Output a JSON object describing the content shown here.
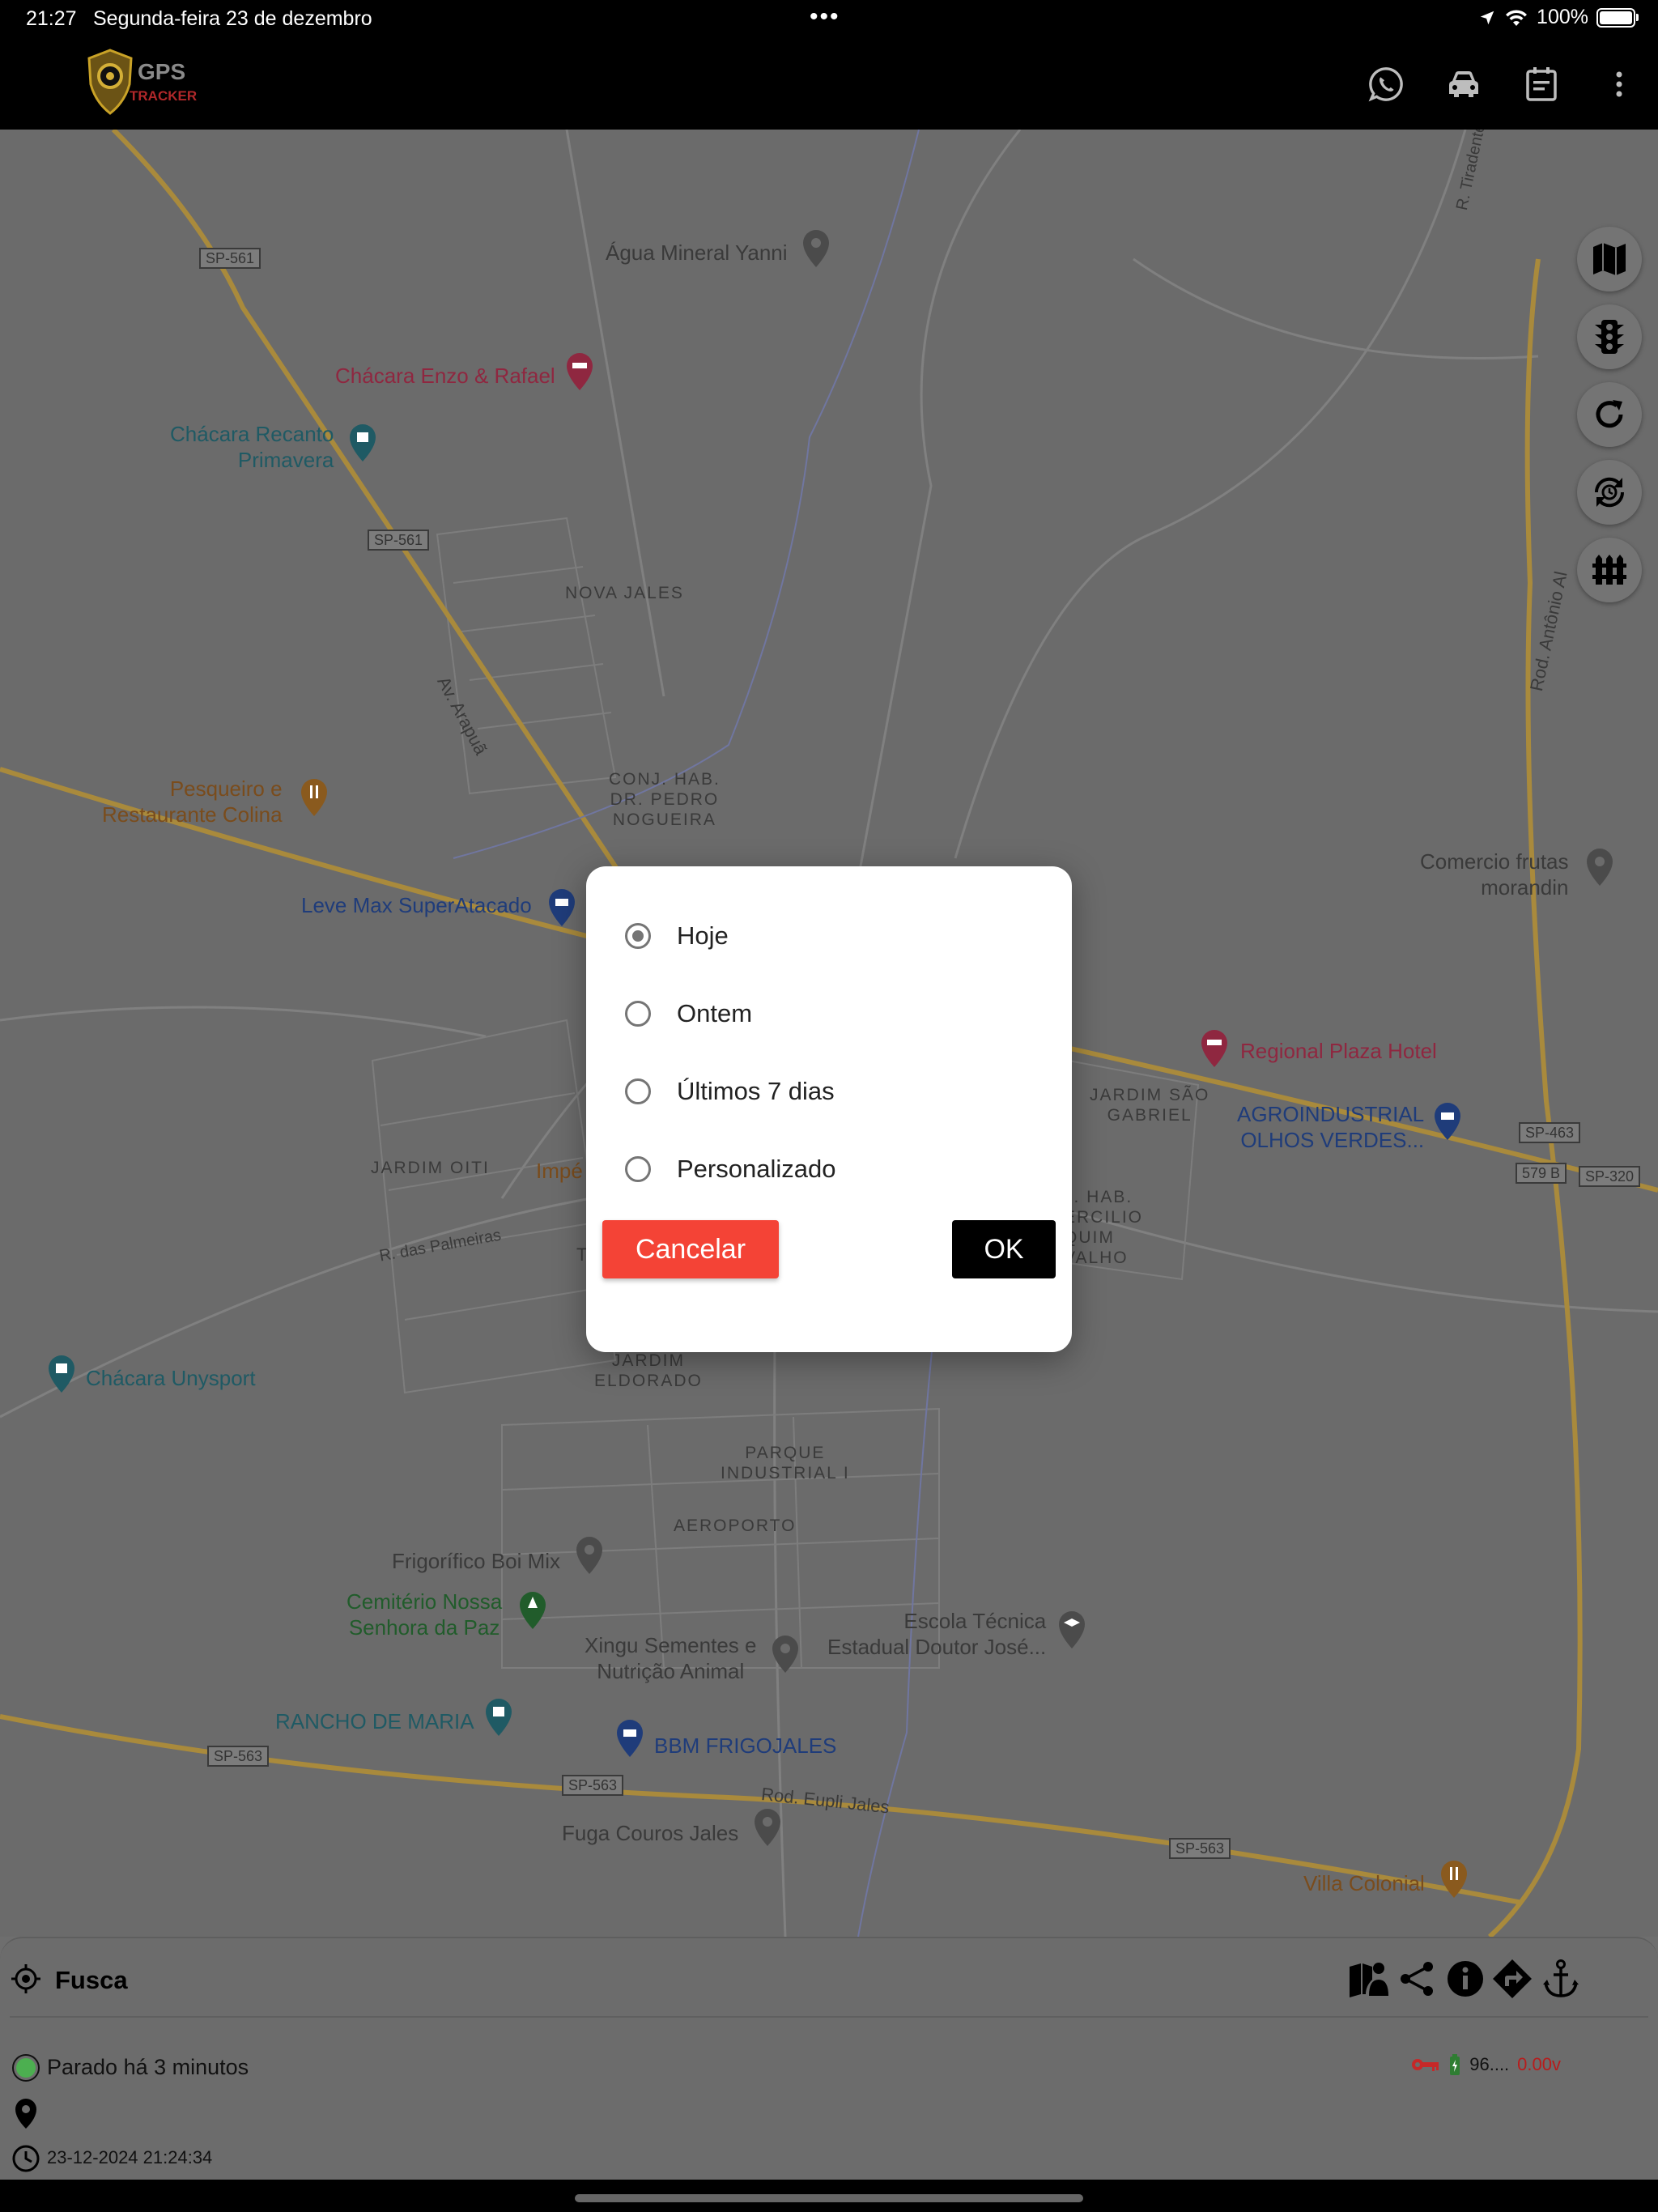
{
  "status_bar": {
    "time": "21:27",
    "date": "Segunda-feira 23 de dezembro",
    "battery": "100%"
  },
  "app": {
    "logo_text_top": "GPS",
    "logo_text_bottom": "TRACKER",
    "icons": [
      "whatsapp-icon",
      "car-icon",
      "calendar-icon",
      "more-vert-icon"
    ]
  },
  "map": {
    "pois": {
      "agua_mineral": "Água Mineral Yanni",
      "chacara_enzo": "Chácara Enzo & Rafael",
      "chacara_recanto": "Chácara Recanto\nPrimavera",
      "pesqueiro": "Pesqueiro e\nRestaurante Colina",
      "leve_max": "Leve Max SuperAtacado",
      "comercio_frutas": "Comercio frutas\nmorandin",
      "regional_plaza": "Regional Plaza Hotel",
      "agroindustrial": "AGROINDUSTRIAL\nOLHOS VERDES...",
      "chacara_unysport": "Chácara Unysport",
      "frigorifico": "Frigorífico Boi Mix",
      "cemiterio": "Cemitério Nossa\nSenhora da Paz",
      "escola": "Escola Técnica\nEstadual Doutor José...",
      "xingu": "Xingu Sementes e\nNutrição Animal",
      "rancho": "RANCHO DE MARIA",
      "bbm": "BBM FRIGOJALES",
      "fuga": "Fuga Couros Jales",
      "villa": "Villa Colonial",
      "impe": "Impé"
    },
    "areas": {
      "nova_jales": "NOVA JALES",
      "conj_hab": "CONJ. HAB.\nDR. PEDRO\nNOGUEIRA",
      "jardim_sao_gabriel": "JARDIM SÃO\nGABRIEL",
      "jardim_oiti": "JARDIM OITI",
      "hab_ercilio": "J. HAB.\nERCILIO\nQUIM\nVALHO",
      "jardim_eldorado": "JARDIM\nELDORADO",
      "parque_industrial": "PARQUE\nINDUSTRIAL I",
      "aeroporto": "AEROPORTO"
    },
    "roads": {
      "av_arapua": "Av. Arapuã",
      "r_tiradentes": "R. Tiradentes",
      "rod_antonio": "Rod. Antônio Al",
      "r_palmeiras": "R. das Palmeiras",
      "rod_eupli": "Rod. Eupli Jales",
      "t_char": "T"
    },
    "shields": {
      "sp561_a": "SP-561",
      "sp561_b": "SP-561",
      "sp463": "SP-463",
      "b579": "579 B",
      "sp320": "SP-320",
      "sp563_a": "SP-563",
      "sp563_b": "SP-563",
      "sp563_c": "SP-563"
    }
  },
  "dialog": {
    "options": [
      "Hoje",
      "Ontem",
      "Últimos 7 dias",
      "Personalizado"
    ],
    "selected": "Hoje",
    "cancel_label": "Cancelar",
    "ok_label": "OK"
  },
  "panel": {
    "vehicle": "Fusca",
    "status": "Parado há 3 minutos",
    "timestamp": "23-12-2024 21:24:34",
    "battery_value": "96....",
    "voltage": "0.00v",
    "colors": {
      "status_green": "#4caf50",
      "key_red": "#c62828",
      "voltage_red": "#b71c1c",
      "battery_green": "#2e7d32"
    }
  }
}
